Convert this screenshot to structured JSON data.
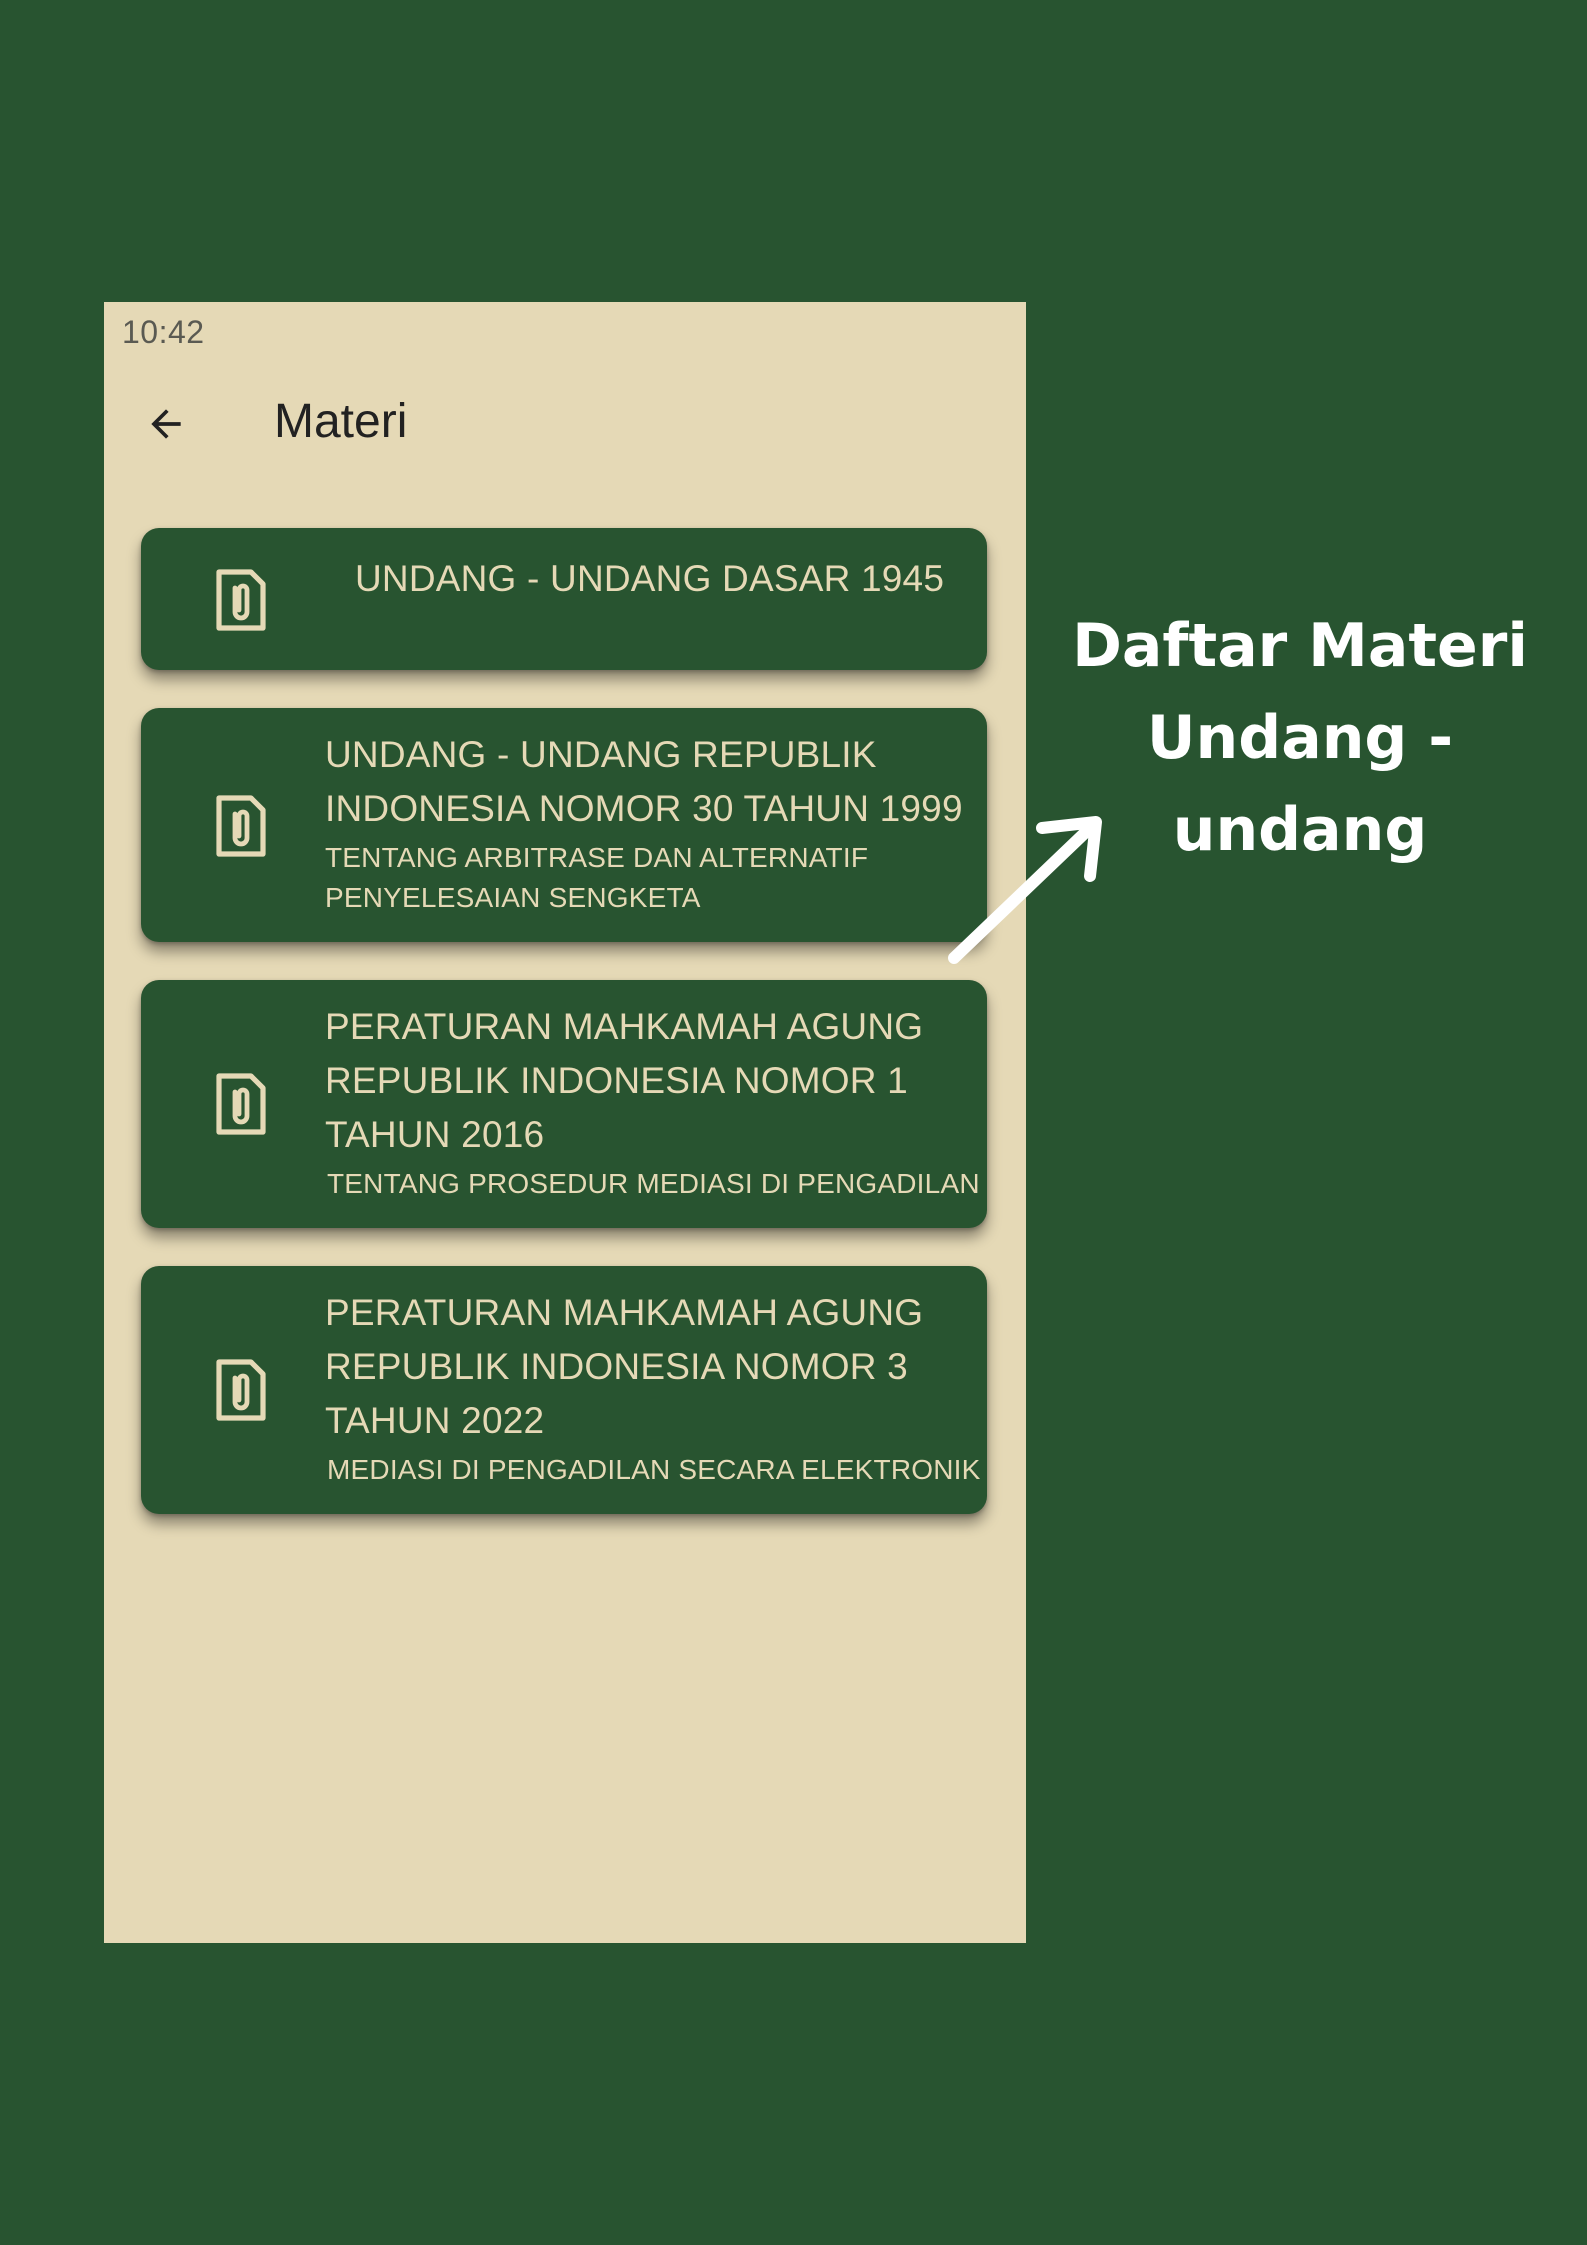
{
  "status_bar": {
    "time": "10:42"
  },
  "app_bar": {
    "title": "Materi",
    "back_icon": "arrow-left-icon"
  },
  "items": [
    {
      "title": "UNDANG - UNDANG DASAR 1945",
      "subtitle": "",
      "icon": "document-attachment-icon"
    },
    {
      "title": "UNDANG - UNDANG REPUBLIK INDONESIA NOMOR 30 TAHUN 1999",
      "subtitle": "TENTANG ARBITRASE DAN ALTERNATIF PENYELESAIAN SENGKETA",
      "icon": "document-attachment-icon"
    },
    {
      "title": "PERATURAN MAHKAMAH AGUNG REPUBLIK INDONESIA NOMOR 1 TAHUN 2016",
      "subtitle": "TENTANG PROSEDUR MEDIASI DI PENGADILAN",
      "icon": "document-attachment-icon"
    },
    {
      "title": "PERATURAN MAHKAMAH AGUNG REPUBLIK INDONESIA NOMOR 3 TAHUN 2022",
      "subtitle": "MEDIASI DI PENGADILAN SECARA ELEKTRONIK",
      "icon": "document-attachment-icon"
    }
  ],
  "annotation": {
    "line1": "Daftar Materi",
    "line2": "Undang - undang",
    "arrow_icon": "arrow-up-right-icon"
  },
  "colors": {
    "background": "#285430",
    "screen": "#e5d9b6",
    "card": "#285430",
    "card_text": "#e5d9b6",
    "annotation_text": "#ffffff"
  }
}
